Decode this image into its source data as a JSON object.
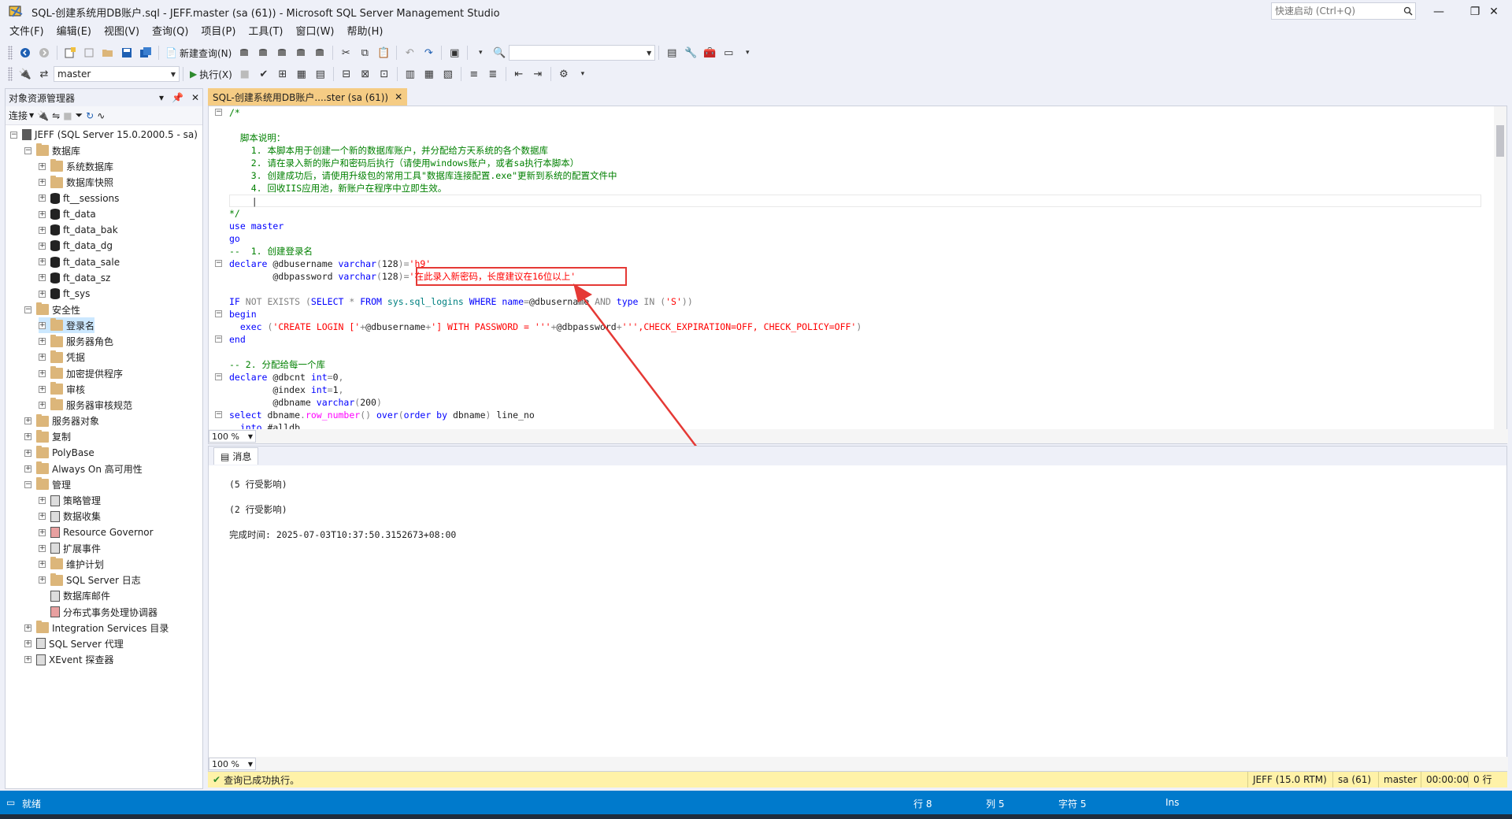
{
  "window": {
    "title": "SQL-创建系统用DB账户.sql - JEFF.master (sa (61)) - Microsoft SQL Server Management Studio",
    "quick_launch_placeholder": "快速启动 (Ctrl+Q)"
  },
  "menu": [
    "文件(F)",
    "编辑(E)",
    "视图(V)",
    "查询(Q)",
    "项目(P)",
    "工具(T)",
    "窗口(W)",
    "帮助(H)"
  ],
  "toolbar": {
    "new_query_label": "新建查询(N)",
    "database_combo": "master",
    "execute_label": "执行(X)"
  },
  "object_explorer": {
    "title": "对象资源管理器",
    "connect_label": "连接",
    "nodes": [
      {
        "label": "JEFF (SQL Server 15.0.2000.5 - sa)",
        "expander": "minus",
        "icon": "server"
      },
      {
        "label": "数据库",
        "expander": "minus",
        "icon": "folder"
      },
      {
        "label": "系统数据库",
        "expander": "plus",
        "icon": "folder"
      },
      {
        "label": "数据库快照",
        "expander": "plus",
        "icon": "folder"
      },
      {
        "label": "ft__sessions",
        "expander": "plus",
        "icon": "database"
      },
      {
        "label": "ft_data",
        "expander": "plus",
        "icon": "database"
      },
      {
        "label": "ft_data_bak",
        "expander": "plus",
        "icon": "database"
      },
      {
        "label": "ft_data_dg",
        "expander": "plus",
        "icon": "database"
      },
      {
        "label": "ft_data_sale",
        "expander": "plus",
        "icon": "database"
      },
      {
        "label": "ft_data_sz",
        "expander": "plus",
        "icon": "database"
      },
      {
        "label": "ft_sys",
        "expander": "plus",
        "icon": "database"
      },
      {
        "label": "安全性",
        "expander": "minus",
        "icon": "folder"
      },
      {
        "label": "登录名",
        "expander": "plus",
        "icon": "folder"
      },
      {
        "label": "服务器角色",
        "expander": "plus",
        "icon": "folder"
      },
      {
        "label": "凭据",
        "expander": "plus",
        "icon": "folder"
      },
      {
        "label": "加密提供程序",
        "expander": "plus",
        "icon": "folder"
      },
      {
        "label": "审核",
        "expander": "plus",
        "icon": "folder"
      },
      {
        "label": "服务器审核规范",
        "expander": "plus",
        "icon": "folder"
      },
      {
        "label": "服务器对象",
        "expander": "plus",
        "icon": "folder"
      },
      {
        "label": "复制",
        "expander": "plus",
        "icon": "folder"
      },
      {
        "label": "PolyBase",
        "expander": "plus",
        "icon": "folder"
      },
      {
        "label": "Always On 高可用性",
        "expander": "plus",
        "icon": "folder"
      },
      {
        "label": "管理",
        "expander": "minus",
        "icon": "folder"
      },
      {
        "label": "策略管理",
        "expander": "plus",
        "icon": "policy"
      },
      {
        "label": "数据收集",
        "expander": "plus",
        "icon": "collection"
      },
      {
        "label": "Resource Governor",
        "expander": "plus",
        "icon": "governor"
      },
      {
        "label": "扩展事件",
        "expander": "plus",
        "icon": "xevent"
      },
      {
        "label": "维护计划",
        "expander": "plus",
        "icon": "folder"
      },
      {
        "label": "SQL Server 日志",
        "expander": "plus",
        "icon": "folder"
      },
      {
        "label": "数据库邮件",
        "expander": "none",
        "icon": "mail"
      },
      {
        "label": "分布式事务处理协调器",
        "expander": "none",
        "icon": "dtc"
      },
      {
        "label": "Integration Services 目录",
        "expander": "plus",
        "icon": "folder"
      },
      {
        "label": "SQL Server 代理",
        "expander": "plus",
        "icon": "agent"
      },
      {
        "label": "XEvent 探查器",
        "expander": "plus",
        "icon": "xevent"
      }
    ]
  },
  "document_tab": {
    "label": "SQL-创建系统用DB账户....ster (sa (61))"
  },
  "editor": {
    "zoom": "100 %",
    "annotation_text": "'在此录入新密码，长度建议在16位以上'"
  },
  "results": {
    "tab_label": "消息",
    "messages": [
      "(5 行受影响)",
      "(2 行受影响)",
      "完成时间: 2025-07-03T10:37:50.3152673+08:00"
    ],
    "zoom": "100 %"
  },
  "query_status": {
    "message": "查询已成功执行。",
    "server": "JEFF (15.0 RTM)",
    "user": "sa (61)",
    "database": "master",
    "elapsed": "00:00:00",
    "rows": "0 行"
  },
  "statusbar": {
    "state": "就绪",
    "line": "行 8",
    "column": "列 5",
    "char": "字符 5",
    "mode": "Ins"
  },
  "colors": {
    "accent": "#007acc",
    "tab_active": "#f5cc84",
    "status_ok": "#fff2a8",
    "annotation": "#e53935"
  }
}
